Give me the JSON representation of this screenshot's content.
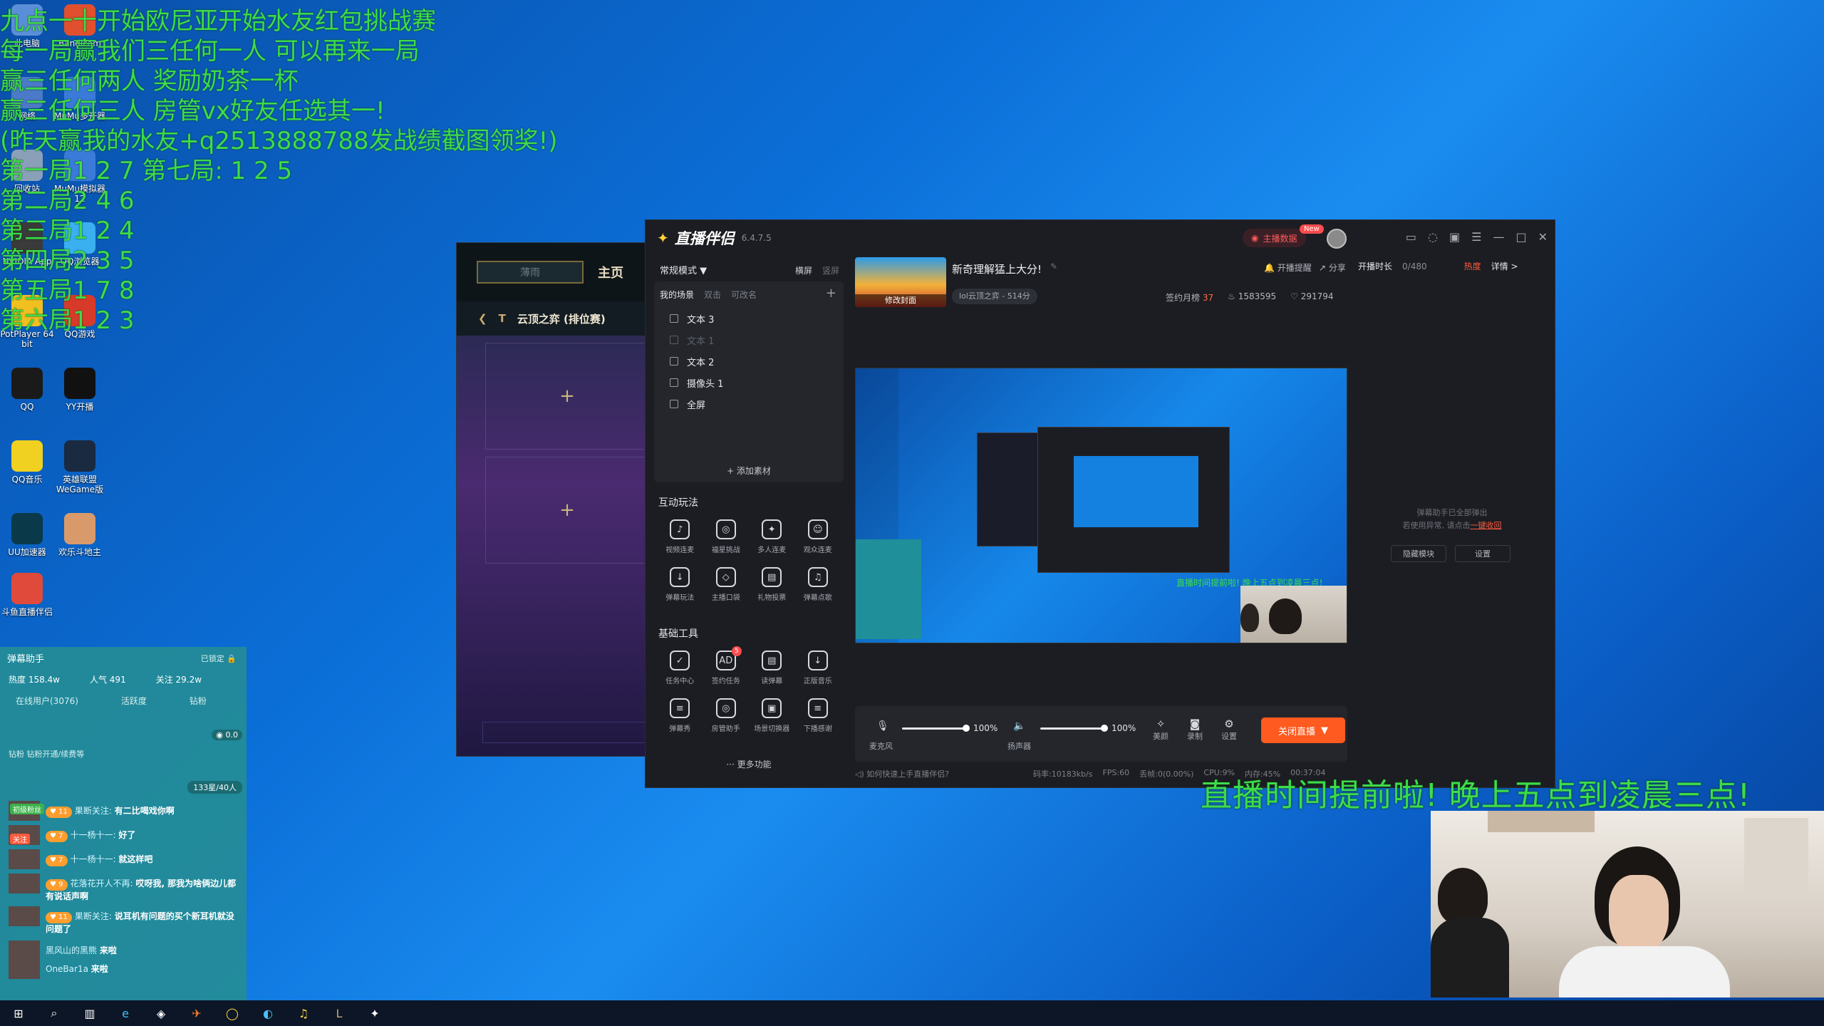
{
  "overlay_lines": [
    "九点一十开始欧尼亚开始水友红包挑战赛",
    "每一局赢我们三任何一人 可以再来一局",
    "赢三任何两人 奖励奶茶一杯",
    "赢三任何三人 房管vx好友任选其一!",
    "(昨天赢我的水友+q2513888788发战绩截图领奖!)",
    "第一局1 2 7 第七局: 1 2 5",
    "第二局2 4 6",
    "第三局1 2 4",
    "第四局2 3 5",
    "第五局1 7 8",
    "第六局1 2 3"
  ],
  "desktop_icons": [
    {
      "label": "此电脑",
      "icon": "computer-icon"
    },
    {
      "label": "Bandicam",
      "icon": "bandicam-icon"
    },
    {
      "label": "网络",
      "icon": "network-icon"
    },
    {
      "label": "MuMu多开器",
      "icon": "mumu-icon"
    },
    {
      "label": "回收站",
      "icon": "recycle-bin-icon"
    },
    {
      "label": "MuMu模拟器12",
      "icon": "mumu-icon"
    },
    {
      "label": "NVIDIA App",
      "icon": "nvidia-icon"
    },
    {
      "label": "QQ浏览器",
      "icon": "qq-browser-icon"
    },
    {
      "label": "PotPlayer 64 bit",
      "icon": "potplayer-icon"
    },
    {
      "label": "QQ游戏",
      "icon": "qq-game-icon"
    },
    {
      "label": "QQ",
      "icon": "qq-icon"
    },
    {
      "label": "YY开播",
      "icon": "yy-icon"
    },
    {
      "label": "QQ音乐",
      "icon": "qq-music-icon"
    },
    {
      "label": "英雄联盟WeGame版",
      "icon": "lol-icon"
    },
    {
      "label": "UU加速器",
      "icon": "uu-icon"
    },
    {
      "label": "欢乐斗地主",
      "icon": "doudizhu-icon"
    },
    {
      "label": "斗鱼直播伴侣",
      "icon": "douyu-icon"
    }
  ],
  "lol": {
    "home_tab": "主页",
    "mode": "云顶之弈 (排位赛)",
    "logo_text": "薄雨"
  },
  "app": {
    "brand": "直播伴侣",
    "version": "6.4.7.5",
    "live_data_label": "主播数据",
    "new_badge": "New",
    "mode_select": "常规模式 ▼",
    "orient_landscape": "横屏",
    "orient_portrait": "竖屏",
    "scene_tabs": [
      "我的场景",
      "双击",
      "可改名"
    ],
    "scenes": [
      {
        "name": "文本 3",
        "dim": false
      },
      {
        "name": "文本 1",
        "dim": true
      },
      {
        "name": "文本 2",
        "dim": false
      },
      {
        "name": "摄像头 1",
        "dim": false
      },
      {
        "name": "全屏",
        "dim": false
      }
    ],
    "add_material": "+ 添加素材",
    "interactive_title": "互动玩法",
    "interactive_tools": [
      "视频连麦",
      "福星挑战",
      "多人连麦",
      "观众连麦",
      "弹幕玩法",
      "主播口袋",
      "礼物投票",
      "弹幕点歌"
    ],
    "basic_title": "基础工具",
    "basic_tools": [
      "任务中心",
      "签约任务",
      "读弹幕",
      "正版音乐",
      "弹幕秀",
      "房管助手",
      "场景切换器",
      "下播感谢"
    ],
    "basic_badge": "5",
    "more": "··· 更多功能",
    "cover_change": "修改封面",
    "room_title": "新奇理解猛上大分!",
    "room_category": "lol云顶之弈 - 514分",
    "open_reminder": "开播提醒",
    "share": "分享",
    "stats": {
      "monthly_label": "签约月榜",
      "monthly_value": "37",
      "fire": "1583595",
      "likes": "291794"
    },
    "preview_caption": "直播时间提前啦! 晚上五点到凌晨三点!",
    "mic_label": "麦克风",
    "mic_pct": "100%",
    "speaker_label": "扬声器",
    "speaker_pct": "100%",
    "mic_level": 1.0,
    "speaker_level": 1.0,
    "btn_beauty": "美颜",
    "btn_record": "录制",
    "btn_settings": "设置",
    "close_live": "关闭直播",
    "help": "如何快速上手直播伴侣?",
    "metrics": [
      "码率:10183kb/s",
      "FPS:60",
      "丢帧:0(0.00%)",
      "CPU:9%",
      "内存:45%",
      "00:37:04"
    ],
    "rp_duration_label": "开播时长",
    "rp_duration_value": "0/480",
    "rp_hot": "热度",
    "rp_detail": "详情 >",
    "rp_msg_line1": "弹幕助手已全部弹出",
    "rp_msg_line2": "若使用异常, 请点击",
    "rp_msg_link": "一键收回",
    "rp_hide": "隐藏模块",
    "rp_settings": "设置"
  },
  "big_caption": "直播时间提前啦! 晚上五点到凌晨三点!",
  "chat": {
    "title": "弹幕助手",
    "locked": "已锁定",
    "hot": "热度 158.4w",
    "popularity": "人气 491",
    "follow": "关注 29.2w",
    "tabs": [
      "在线用户(3076)",
      "活跃度",
      "钻粉"
    ],
    "balance": "0.0",
    "notice": "钻粉 钻粉开通/续费等",
    "count_badge": "133星/40人",
    "lines": [
      {
        "level": "11",
        "user": "果断关注:",
        "text": "有二比喝戏你啊"
      },
      {
        "level": "7",
        "user": "十一杨十一:",
        "text": "好了"
      },
      {
        "level": "7",
        "user": "十一杨十一:",
        "text": "就这样吧"
      },
      {
        "level": "9",
        "user": "花落花开人不再:",
        "text": "哎呀我, 那我为啥俩边儿都有说话声啊"
      },
      {
        "level": "11",
        "user": "果断关注:",
        "text": "说耳机有问题的买个新耳机就没问题了"
      },
      {
        "level": "",
        "user": "黑风山的黑熊",
        "text": "来啦"
      },
      {
        "level": "",
        "user": "OneBar1a",
        "text": "来啦"
      }
    ],
    "tag_fans": "初级粉丝",
    "tag_follow": "关注"
  },
  "colors": {
    "overlay_green": "#3ddc4a",
    "accent_orange": "#ff5a1f",
    "app_bg": "#1c1d22"
  }
}
